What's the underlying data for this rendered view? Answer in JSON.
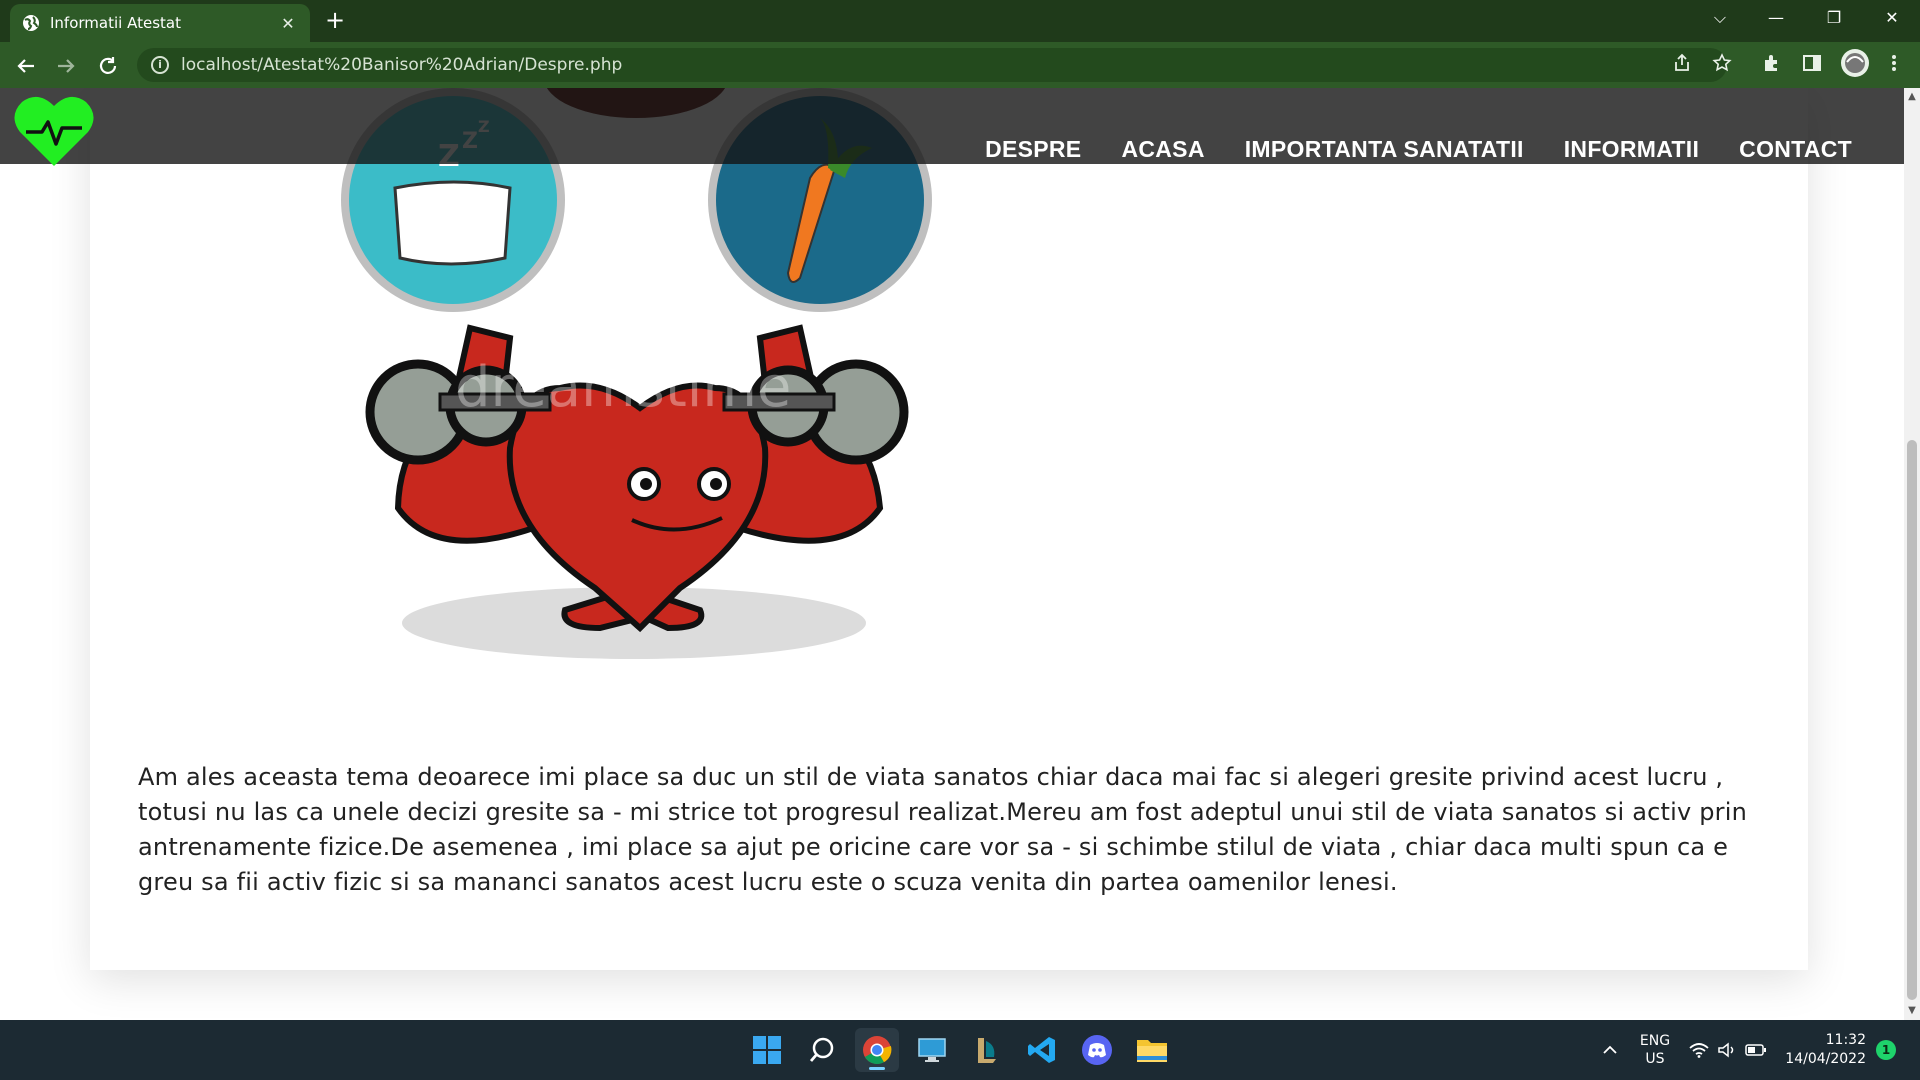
{
  "browser": {
    "tab_title": "Informatii Atestat",
    "url": "localhost/Atestat%20Banisor%20Adrian/Despre.php",
    "new_tab_symbol": "+",
    "tab_close_symbol": "✕",
    "window_controls": {
      "tab_search": "⌵",
      "minimize": "—",
      "restore": "❐",
      "close": "✕"
    },
    "toolbar_icons": [
      "share-icon",
      "bookmark-star-icon",
      "extensions-icon",
      "side-panel-icon",
      "profile-avatar-icon",
      "menu-kebab-icon"
    ],
    "theme_color": "#2e5a27"
  },
  "site": {
    "nav": [
      {
        "label": "DESPRE"
      },
      {
        "label": "ACASA"
      },
      {
        "label": "IMPORTANTA SANATATII"
      },
      {
        "label": "INFORMATII"
      },
      {
        "label": "CONTACT"
      }
    ],
    "logo_color": "#22ee22",
    "hero_watermark": "dreamstime",
    "about_paragraph": "Am ales aceasta tema deoarece imi place sa duc un stil de viata sanatos chiar daca mai fac si alegeri gresite privind acest lucru , totusi nu las ca unele decizi gresite sa - mi strice tot progresul realizat.Mereu am fost adeptul unui stil de viata sanatos si activ prin antrenamente fizice.De asemenea , imi place sa ajut pe oricine care vor sa - si schimbe stilul de viata , chiar daca multi spun ca e greu sa fii activ fizic si sa mananci sanatos acest lucru este o scuza venita din partea oamenilor lenesi."
  },
  "taskbar": {
    "apps": [
      "windows-start-icon",
      "search-icon",
      "chrome-icon",
      "desktop-icon",
      "league-client-icon",
      "vscode-icon",
      "discord-icon",
      "file-explorer-icon"
    ],
    "tray": {
      "language_line1": "ENG",
      "language_line2": "US",
      "time": "11:32",
      "date": "14/04/2022",
      "notification_count": "1"
    }
  }
}
